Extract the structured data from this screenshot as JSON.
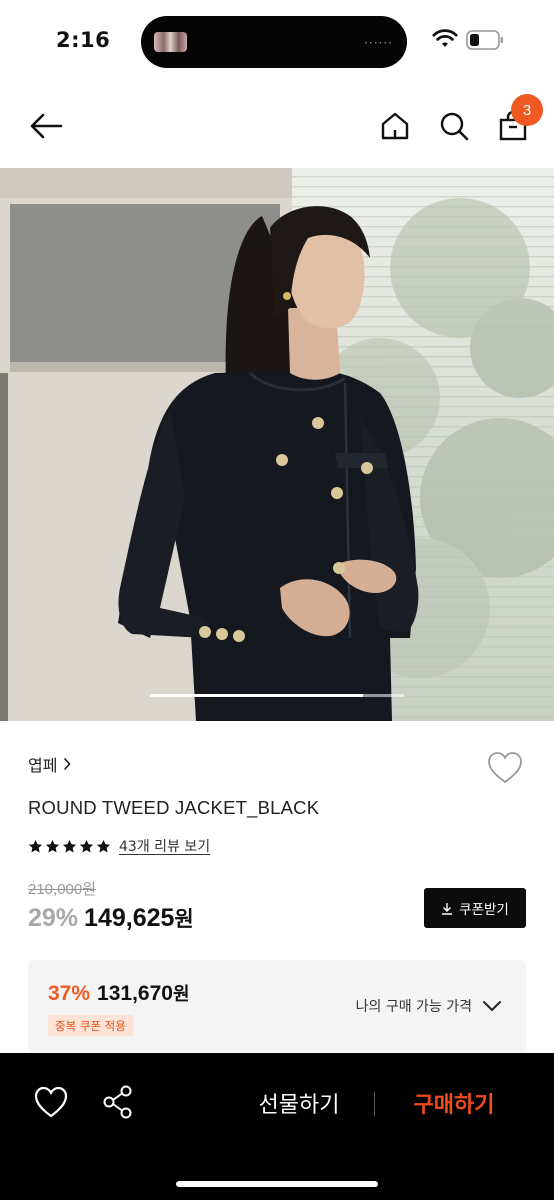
{
  "status_bar": {
    "time": "2:16"
  },
  "nav": {
    "cart_count": "3"
  },
  "gallery": {
    "progress": 0.84
  },
  "product": {
    "brand": "엽페",
    "name": "ROUND TWEED JACKET_BLACK",
    "rating_stars": 5,
    "review_link": "43개 리뷰 보기",
    "original_price": "210,000원",
    "discount_rate": "29%",
    "sale_price": "149,625",
    "sale_unit": "원",
    "coupon_button": "쿠폰받기"
  },
  "my_price": {
    "rate": "37%",
    "amount": "131,670",
    "unit": "원",
    "tag": "중복 쿠폰 적용",
    "toggle_label": "나의 구매 가능 가격"
  },
  "bottom_bar": {
    "gift_label": "선물하기",
    "buy_label": "구매하기"
  },
  "colors": {
    "accent": "#f05a22",
    "buy": "#f24b1a",
    "dark": "#0c0c0c"
  }
}
